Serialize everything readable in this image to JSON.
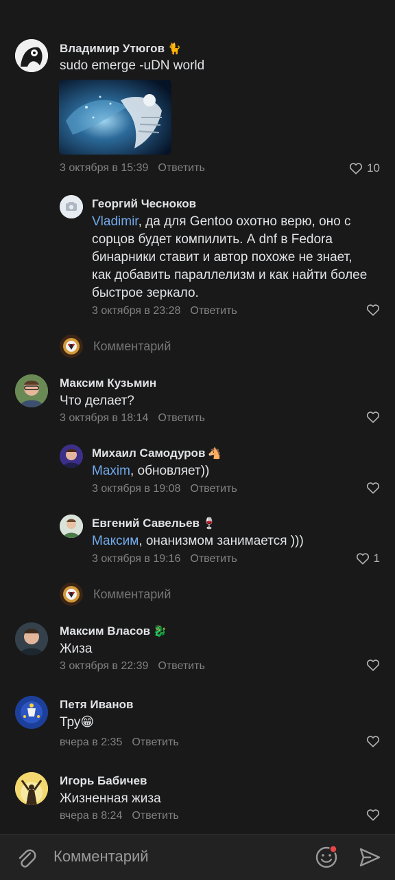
{
  "comments": [
    {
      "author": "Владимир Утюгов",
      "badge": "🐈",
      "text": "sudo emerge -uDN world",
      "time": "3 октября в 15:39",
      "reply": "Ответить",
      "likes": "10"
    },
    {
      "author": "Георгий Чесноков",
      "mention": "Vladimir",
      "text": ", да для Gentoo охотно верю, оно с сорцов будет компилить. А dnf в Fedora бинарники ставит и автор похоже не знает, как добавить параллелизм и как найти более быстрое зеркало.",
      "time": "3 октября в 23:28",
      "reply": "Ответить"
    },
    {
      "author": "Максим Кузьмин",
      "text": "Что делает?",
      "time": "3 октября в 18:14",
      "reply": "Ответить"
    },
    {
      "author": "Михаил Самодуров",
      "badge": "🐴",
      "mention": "Maxim",
      "text": ", обновляет))",
      "time": "3 октября в 19:08",
      "reply": "Ответить"
    },
    {
      "author": "Евгений Савельев",
      "badge": "🍷",
      "mention": "Максим",
      "text": ", онанизмом занимается )))",
      "time": "3 октября в 19:16",
      "reply": "Ответить",
      "likes": "1"
    },
    {
      "author": "Максим Власов",
      "badge": "🐉",
      "text": "Жиза",
      "time": "3 октября в 22:39",
      "reply": "Ответить"
    },
    {
      "author": "Петя Иванов",
      "text": "Тру😁",
      "time": "вчера в 2:35",
      "reply": "Ответить"
    },
    {
      "author": "Игорь Бабичев",
      "text": "Жизненная жиза",
      "time": "вчера в 8:24",
      "reply": "Ответить"
    }
  ],
  "inline_reply_label": "Комментарий",
  "composer": {
    "placeholder": "Комментарий",
    "icons": {
      "attach": "paperclip-icon",
      "emoji": "smiley-icon",
      "send": "send-icon"
    }
  },
  "colors": {
    "background": "#191919",
    "mention": "#71aaeb",
    "meta": "#828282"
  }
}
